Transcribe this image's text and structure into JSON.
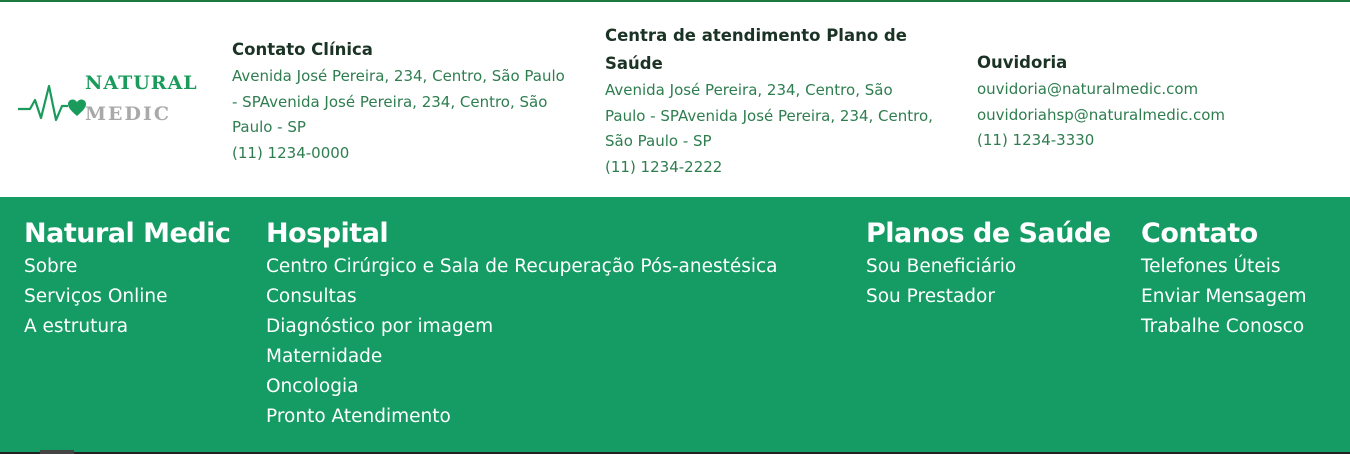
{
  "logo": {
    "line1": "NATURAL",
    "line2": "MEDIC",
    "icon": "heartbeat-heart-icon",
    "color_primary": "#1a9b5c",
    "color_secondary": "#a9a9a9"
  },
  "info": {
    "clinica": {
      "title": "Contato Clínica",
      "address": "Avenida José Pereira, 234, Centro, São Paulo - SPAvenida José Pereira, 234, Centro, São Paulo - SP",
      "phone": "(11) 1234-0000"
    },
    "plano": {
      "title": "Centra de atendimento Plano de Saúde",
      "address": "Avenida José Pereira, 234, Centro, São Paulo - SPAvenida José Pereira, 234, Centro, São Paulo - SP",
      "phone": "(11) 1234-2222"
    },
    "ouvidoria": {
      "title": "Ouvidoria",
      "email1": "ouvidoria@naturalmedic.com",
      "email2": "ouvidoriahsp@naturalmedic.com",
      "phone": "(11) 1234-3330"
    }
  },
  "footer": {
    "background": "#149c64",
    "natural_medic": {
      "title": "Natural Medic",
      "links": [
        "Sobre",
        "Serviços Online",
        "A estrutura"
      ]
    },
    "hospital": {
      "title": "Hospital",
      "links": [
        "Centro Cirúrgico e Sala de Recuperação Pós-anestésica",
        "Consultas",
        "Diagnóstico por imagem",
        "Maternidade",
        "Oncologia",
        "Pronto Atendimento"
      ]
    },
    "planos": {
      "title": "Planos de Saúde",
      "links": [
        "Sou Beneficiário",
        "Sou Prestador"
      ]
    },
    "contato": {
      "title": "Contato",
      "links": [
        "Telefones Úteis",
        "Enviar Mensagem",
        "Trabalhe Conosco"
      ]
    }
  }
}
